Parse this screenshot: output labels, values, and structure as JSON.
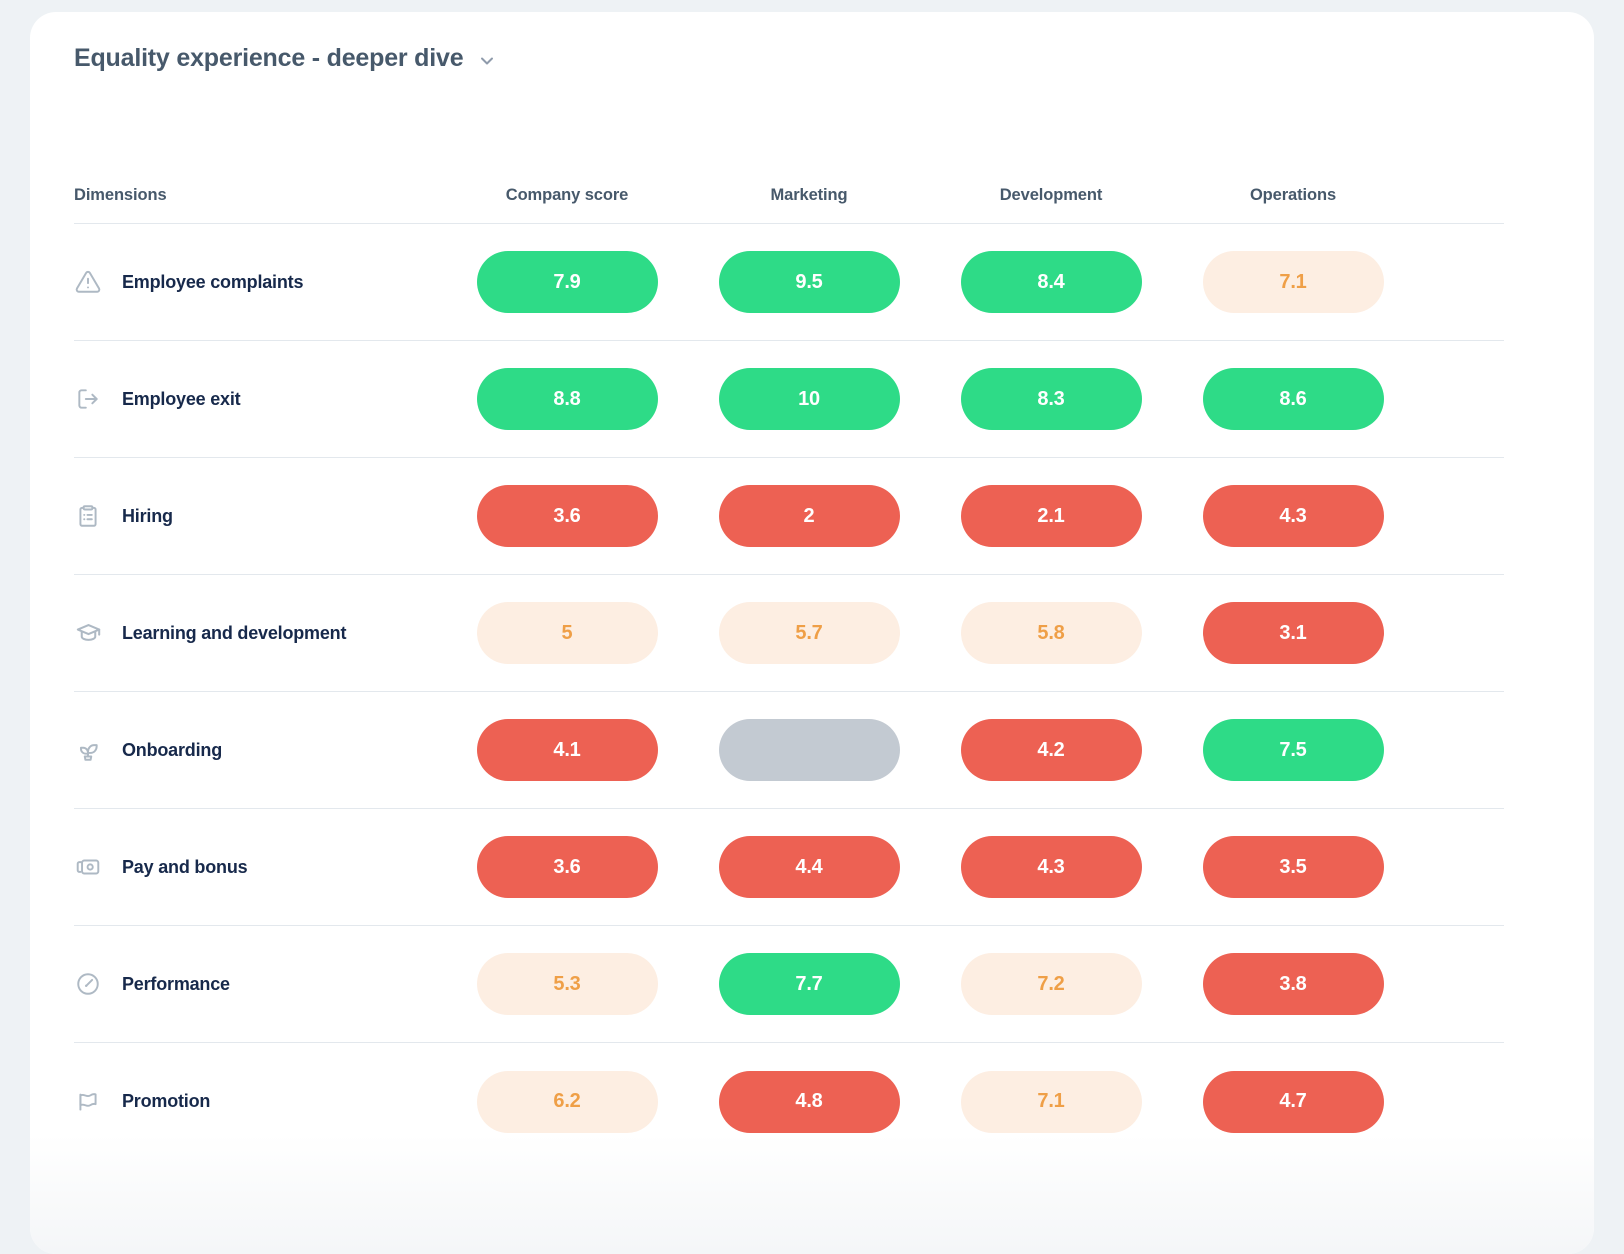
{
  "header": {
    "title": "Equality experience - deeper dive",
    "expand_icon": "chevron-down-icon"
  },
  "table": {
    "columns": [
      {
        "key": "dimensions",
        "label": "Dimensions"
      },
      {
        "key": "company_score",
        "label": "Company score"
      },
      {
        "key": "marketing",
        "label": "Marketing"
      },
      {
        "key": "development",
        "label": "Development"
      },
      {
        "key": "operations",
        "label": "Operations"
      }
    ],
    "rows": [
      {
        "icon": "warning-triangle-icon",
        "label": "Employee complaints",
        "cells": [
          {
            "value": "7.9",
            "status": "good"
          },
          {
            "value": "9.5",
            "status": "good"
          },
          {
            "value": "8.4",
            "status": "good"
          },
          {
            "value": "7.1",
            "status": "neutral"
          }
        ]
      },
      {
        "icon": "exit-door-icon",
        "label": "Employee exit",
        "cells": [
          {
            "value": "8.8",
            "status": "good"
          },
          {
            "value": "10",
            "status": "good"
          },
          {
            "value": "8.3",
            "status": "good"
          },
          {
            "value": "8.6",
            "status": "good"
          }
        ]
      },
      {
        "icon": "clipboard-checklist-icon",
        "label": "Hiring",
        "cells": [
          {
            "value": "3.6",
            "status": "bad"
          },
          {
            "value": "2",
            "status": "bad"
          },
          {
            "value": "2.1",
            "status": "bad"
          },
          {
            "value": "4.3",
            "status": "bad"
          }
        ]
      },
      {
        "icon": "graduation-cap-icon",
        "label": "Learning and development",
        "cells": [
          {
            "value": "5",
            "status": "neutral"
          },
          {
            "value": "5.7",
            "status": "neutral"
          },
          {
            "value": "5.8",
            "status": "neutral"
          },
          {
            "value": "3.1",
            "status": "bad"
          }
        ]
      },
      {
        "icon": "seedling-icon",
        "label": "Onboarding",
        "cells": [
          {
            "value": "4.1",
            "status": "bad"
          },
          {
            "value": "",
            "status": "empty"
          },
          {
            "value": "4.2",
            "status": "bad"
          },
          {
            "value": "7.5",
            "status": "good"
          }
        ]
      },
      {
        "icon": "money-note-icon",
        "label": "Pay and bonus",
        "cells": [
          {
            "value": "3.6",
            "status": "bad"
          },
          {
            "value": "4.4",
            "status": "bad"
          },
          {
            "value": "4.3",
            "status": "bad"
          },
          {
            "value": "3.5",
            "status": "bad"
          }
        ]
      },
      {
        "icon": "gauge-icon",
        "label": "Performance",
        "cells": [
          {
            "value": "5.3",
            "status": "neutral"
          },
          {
            "value": "7.7",
            "status": "good"
          },
          {
            "value": "7.2",
            "status": "neutral"
          },
          {
            "value": "3.8",
            "status": "bad"
          }
        ]
      },
      {
        "icon": "flag-icon",
        "label": "Promotion",
        "cells": [
          {
            "value": "6.2",
            "status": "neutral"
          },
          {
            "value": "4.8",
            "status": "bad"
          },
          {
            "value": "7.1",
            "status": "neutral"
          },
          {
            "value": "4.7",
            "status": "bad"
          }
        ]
      }
    ]
  },
  "colors": {
    "good": "#2edb87",
    "bad": "#ed6153",
    "neutral_bg": "#fdeee2",
    "neutral_text": "#ef9f47",
    "empty": "#c3cad2",
    "page_bg": "#eef2f5",
    "card_bg": "#ffffff",
    "title_text": "#47596b",
    "row_label_text": "#17294b",
    "divider": "#e3e8ed"
  }
}
